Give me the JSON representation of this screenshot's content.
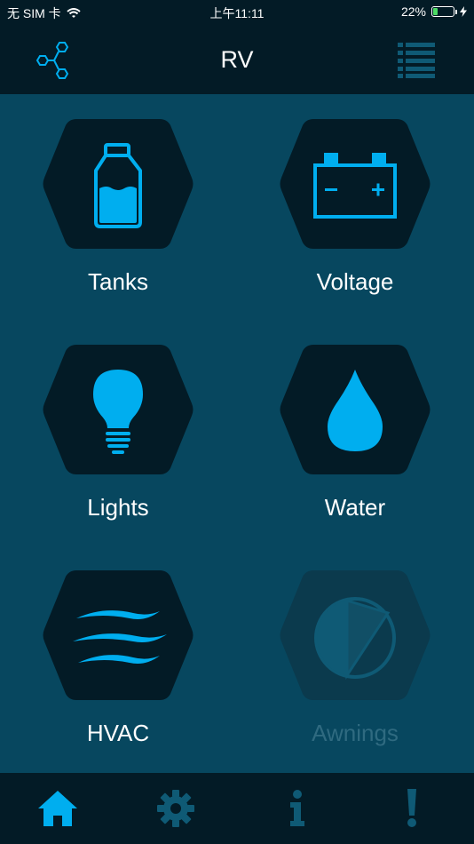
{
  "status": {
    "carrier": "无 SIM 卡",
    "time": "上午11:11",
    "battery": "22%",
    "battery_level": 0.22
  },
  "header": {
    "title": "RV",
    "left_icon": "network-icon",
    "right_icon": "list-icon"
  },
  "colors": {
    "accent": "#00aeef",
    "background": "#07475f",
    "bar": "#031b26",
    "hex": "#031b26",
    "disabled_hex": "#0b3a4d",
    "disabled_icon": "#2f6a80"
  },
  "tiles": [
    {
      "label": "Tanks",
      "icon": "bottle-icon",
      "enabled": true
    },
    {
      "label": "Voltage",
      "icon": "battery-icon",
      "enabled": true
    },
    {
      "label": "Lights",
      "icon": "lightbulb-icon",
      "enabled": true
    },
    {
      "label": "Water",
      "icon": "water-drop-icon",
      "enabled": true
    },
    {
      "label": "HVAC",
      "icon": "airflow-icon",
      "enabled": true
    },
    {
      "label": "Awnings",
      "icon": "awning-icon",
      "enabled": false
    }
  ],
  "tabs": [
    {
      "icon": "home-icon",
      "active": true
    },
    {
      "icon": "gear-icon",
      "active": false
    },
    {
      "icon": "info-icon",
      "active": false
    },
    {
      "icon": "alert-icon",
      "active": false
    }
  ]
}
